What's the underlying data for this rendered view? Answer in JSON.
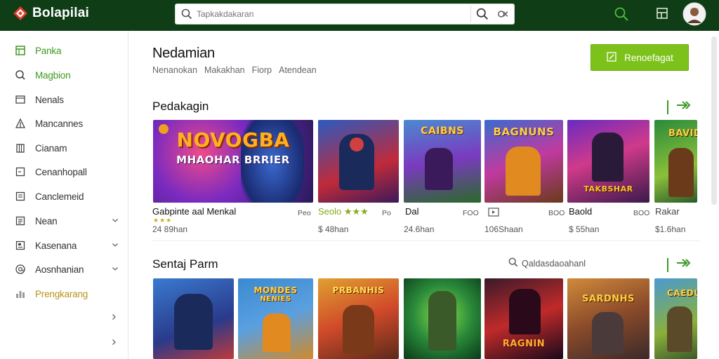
{
  "app": {
    "name": "Bolapilai",
    "accent": "#7cc21a",
    "header_bg": "#0e3d16"
  },
  "search": {
    "placeholder": "Tapkakdakaran",
    "value": ""
  },
  "sidebar": {
    "items": [
      {
        "label": "Panka",
        "icon": "calendar-icon",
        "state": "active"
      },
      {
        "label": "Magbion",
        "icon": "search-icon"
      },
      {
        "label": "Nenals",
        "icon": "window-icon"
      },
      {
        "label": "Mancannes",
        "icon": "triangle-icon"
      },
      {
        "label": "Cianam",
        "icon": "building-icon"
      },
      {
        "label": "Cenanhopall",
        "icon": "square-icon"
      },
      {
        "label": "Canclemeid",
        "icon": "list-icon"
      },
      {
        "label": "Nean",
        "icon": "document-icon",
        "expandable": true
      },
      {
        "label": "Kasenana",
        "icon": "news-icon",
        "expandable": true
      },
      {
        "label": "Aosnhanian",
        "icon": "at-icon",
        "expandable": true
      },
      {
        "label": "Prengkarang",
        "icon": "chart-icon",
        "state": "highlight"
      }
    ]
  },
  "main": {
    "title": "Nedamian",
    "breadcrumb": [
      "Nenanokan",
      "Makakhan",
      "Fiorp",
      "Atendean"
    ],
    "primary_button": "Renoefagat",
    "section1": {
      "title": "Pedakagin",
      "cards": [
        {
          "art_title": "NOVOGBA",
          "art_sub": "MHAOHAR BRRIER",
          "title": "Gabpinte aal Menkal",
          "right": "Peo",
          "sub": "24 89han",
          "stars": "★★★"
        },
        {
          "art_title": "",
          "art_sub": "",
          "title": "Seolo ★★★",
          "right": "Po",
          "sub": "$ 48han"
        },
        {
          "art_title": "CAIBNS",
          "art_sub": "",
          "title": "Dal",
          "right": "FOO",
          "sub": "24.6han"
        },
        {
          "art_title": "BAGNUNS",
          "art_sub": "",
          "title": "",
          "right": "BOO",
          "sub": "106Shaan"
        },
        {
          "art_title": "",
          "art_sub": "TAKBSHAR",
          "title": "Baold",
          "right": "BOO",
          "sub": "$ 55han"
        },
        {
          "art_title": "BAVID",
          "art_sub": "",
          "title": "Rakar",
          "right": "",
          "sub": "$1.6han"
        }
      ]
    },
    "section2": {
      "title": "Sentaj Parm",
      "search_label": "Qaldasdaoahanl",
      "cards": [
        {
          "art_title": "",
          "art_sub": ""
        },
        {
          "art_title": "MONDES",
          "art_sub": "NENIES"
        },
        {
          "art_title": "PRBANHIS",
          "art_sub": ""
        },
        {
          "art_title": "",
          "art_sub": ""
        },
        {
          "art_title": "RAGNIN",
          "art_sub": ""
        },
        {
          "art_title": "SARDNHS",
          "art_sub": ""
        },
        {
          "art_title": "CAEDUS",
          "art_sub": ""
        }
      ]
    }
  }
}
